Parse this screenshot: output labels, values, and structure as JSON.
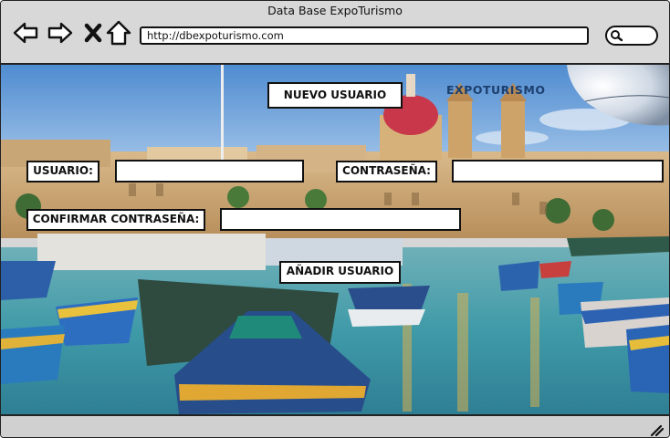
{
  "window": {
    "title": "Data Base ExpoTurismo"
  },
  "toolbar": {
    "back_icon": "arrow-left-icon",
    "forward_icon": "arrow-right-icon",
    "stop_icon": "close-icon",
    "home_icon": "home-icon",
    "url": "http://dbexpoturismo.com",
    "search_icon": "search-icon"
  },
  "page": {
    "heading": "NUEVO USUARIO",
    "brand": "EXPOTURISMO",
    "form": {
      "usuario_label": "USUARIO:",
      "usuario_value": "",
      "password_label": "CONTRASEÑA:",
      "password_value": "",
      "confirm_label": "CONFIRMAR CONTRASEÑA:",
      "confirm_value": "",
      "submit_label": "AÑADIR USUARIO"
    },
    "background_image": "harbor-boats-photo"
  },
  "colors": {
    "brand": "#1c3f6e",
    "sky": "#5d94cf",
    "water": "#3d9fb0"
  }
}
